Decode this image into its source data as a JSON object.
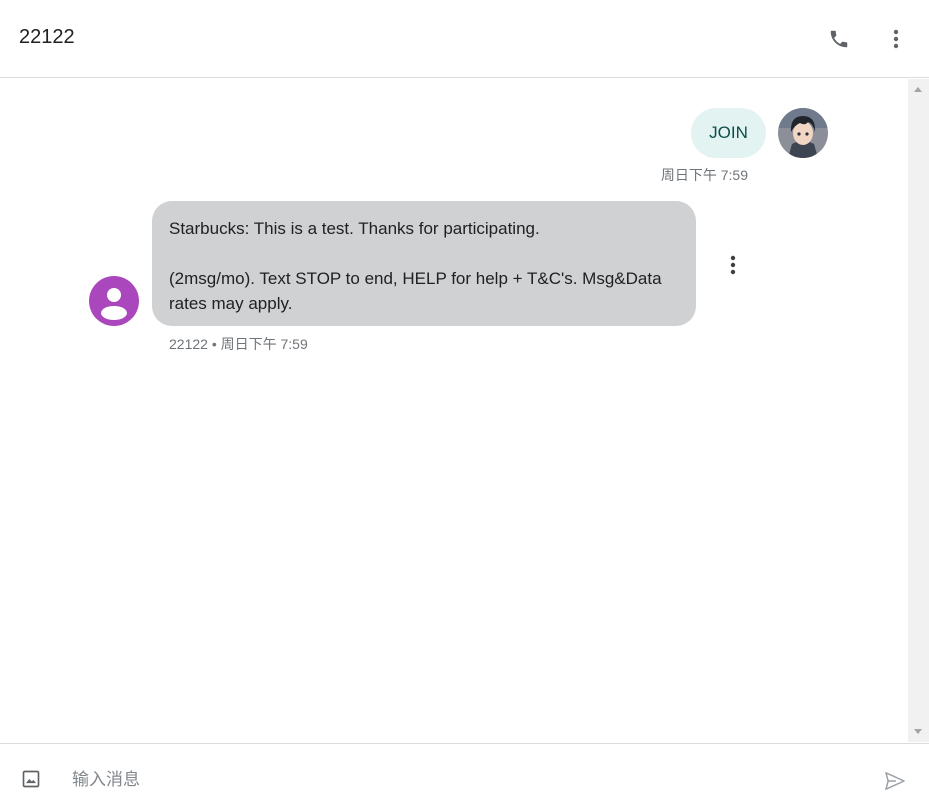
{
  "header": {
    "title": "22122",
    "phone_icon": "phone-icon",
    "more_icon": "more-vert-icon"
  },
  "messages": {
    "outgoing": {
      "text": "JOIN",
      "time": "周日下午 7:59",
      "avatar": "user-avatar"
    },
    "incoming": {
      "line1": "Starbucks: This is a test. Thanks for participating.",
      "line2": "(2msg/mo). Text STOP to end, HELP for help + T&C's. Msg&Data rates may apply.",
      "meta": "22122 • 周日下午 7:59",
      "avatar": "person-icon",
      "more_icon": "more-vert-icon"
    }
  },
  "composer": {
    "placeholder": "输入消息",
    "value": "",
    "attach_icon": "image-icon",
    "send_icon": "send-icon"
  },
  "colors": {
    "outgoing_bubble": "#e3f3f2",
    "incoming_bubble": "#d0d1d3",
    "sender_avatar": "#ab47bc",
    "meta_text": "#70757a"
  }
}
